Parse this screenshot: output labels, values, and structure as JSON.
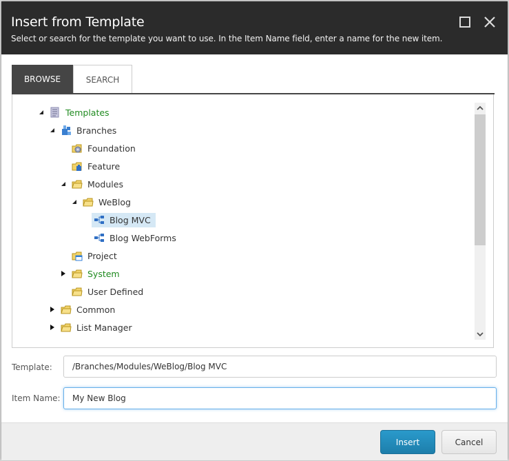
{
  "dialog": {
    "title": "Insert from Template",
    "subtitle": "Select or search for the template you want to use. In the Item Name field, enter a name for the new item."
  },
  "tabs": [
    {
      "label": "BROWSE",
      "active": true
    },
    {
      "label": "SEARCH",
      "active": false
    }
  ],
  "tree": [
    {
      "label": "Templates",
      "level": 0,
      "toggle": "expanded",
      "icon": "template-folder-icon",
      "green": true,
      "selected": false
    },
    {
      "label": "Branches",
      "level": 1,
      "toggle": "expanded",
      "icon": "branches-icon",
      "green": false,
      "selected": false
    },
    {
      "label": "Foundation",
      "level": 2,
      "toggle": "none",
      "icon": "foundation-folder-icon",
      "green": false,
      "selected": false
    },
    {
      "label": "Feature",
      "level": 2,
      "toggle": "none",
      "icon": "feature-folder-icon",
      "green": false,
      "selected": false
    },
    {
      "label": "Modules",
      "level": 2,
      "toggle": "expanded",
      "icon": "folder-icon",
      "green": false,
      "selected": false
    },
    {
      "label": "WeBlog",
      "level": 3,
      "toggle": "expanded",
      "icon": "folder-icon",
      "green": false,
      "selected": false
    },
    {
      "label": "Blog MVC",
      "level": 4,
      "toggle": "none",
      "icon": "branch-template-icon",
      "green": false,
      "selected": true
    },
    {
      "label": "Blog WebForms",
      "level": 4,
      "toggle": "none",
      "icon": "branch-template-icon",
      "green": false,
      "selected": false
    },
    {
      "label": "Project",
      "level": 2,
      "toggle": "none",
      "icon": "project-folder-icon",
      "green": false,
      "selected": false
    },
    {
      "label": "System",
      "level": 2,
      "toggle": "collapsed",
      "icon": "folder-icon",
      "green": true,
      "selected": false
    },
    {
      "label": "User Defined",
      "level": 2,
      "toggle": "none",
      "icon": "folder-icon",
      "green": false,
      "selected": false
    },
    {
      "label": "Common",
      "level": 1,
      "toggle": "collapsed",
      "icon": "folder-icon",
      "green": false,
      "selected": false
    },
    {
      "label": "List Manager",
      "level": 1,
      "toggle": "collapsed",
      "icon": "folder-icon",
      "green": false,
      "selected": false
    }
  ],
  "form": {
    "template_label": "Template:",
    "template_value": "/Branches/Modules/WeBlog/Blog MVC",
    "item_name_label": "Item Name:",
    "item_name_value": "My New Blog"
  },
  "buttons": {
    "insert": "Insert",
    "cancel": "Cancel"
  },
  "colors": {
    "header_bg": "#2b2b2b",
    "active_tab_bg": "#454545",
    "selection_bg": "#d5e8f5",
    "green_text": "#1f8a1f",
    "primary_button": "#1d7eab"
  }
}
